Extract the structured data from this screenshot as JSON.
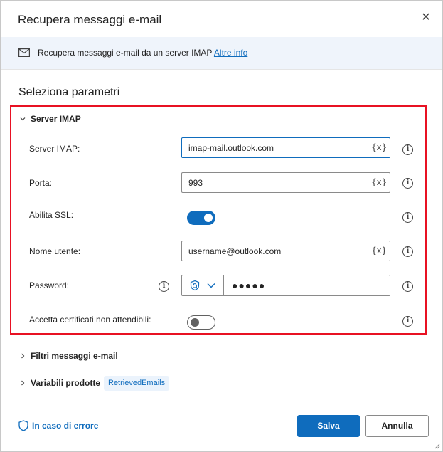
{
  "dialog": {
    "title": "Recupera messaggi e-mail",
    "close_icon": "close-icon"
  },
  "infobar": {
    "icon": "mail-icon",
    "text": "Recupera messaggi e-mail da un server IMAP",
    "link": "Altre info"
  },
  "section_title": "Seleziona parametri",
  "server_group": {
    "label": "Server IMAP",
    "expanded": true,
    "fields": {
      "server": {
        "label": "Server IMAP:",
        "value": "imap-mail.outlook.com",
        "var_label": "{x}"
      },
      "port": {
        "label": "Porta:",
        "value": "993",
        "var_label": "{x}"
      },
      "ssl": {
        "label": "Abilita SSL:",
        "enabled": true
      },
      "username": {
        "label": "Nome utente:",
        "value": "username@outlook.com",
        "var_label": "{x}"
      },
      "password": {
        "label": "Password:",
        "masked_value": "●●●●●"
      },
      "untrusted": {
        "label": "Accetta certificati non attendibili:",
        "enabled": false
      }
    }
  },
  "filters_group": {
    "label": "Filtri messaggi e-mail",
    "expanded": false
  },
  "vars_group": {
    "label": "Variabili prodotte",
    "expanded": false,
    "chip": "RetrievedEmails"
  },
  "footer": {
    "on_error": "In caso di errore",
    "save": "Salva",
    "cancel": "Annulla"
  },
  "colors": {
    "accent": "#0f6cbd",
    "highlight_border": "#e81123",
    "infobar_bg": "#eff4fb"
  }
}
